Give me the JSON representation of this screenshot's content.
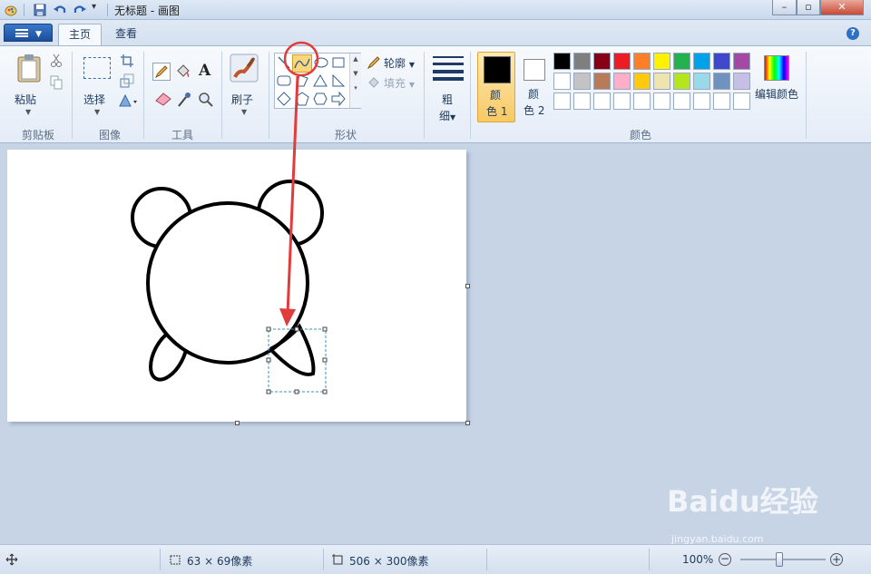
{
  "window": {
    "title": "无标题 - 画图"
  },
  "tabs": [
    {
      "label": "主页"
    },
    {
      "label": "查看"
    }
  ],
  "ribbon": {
    "clipboard": {
      "paste_label": "粘贴",
      "group_label": "剪贴板"
    },
    "image": {
      "select_label": "选择",
      "group_label": "图像"
    },
    "tools": {
      "group_label": "工具"
    },
    "brushes": {
      "label": "刷子"
    },
    "shapes": {
      "outline_label": "轮廓",
      "fill_label": "填充",
      "group_label": "形状"
    },
    "size": {
      "label_line1": "粗",
      "label_line2": "细"
    },
    "colors": {
      "color1_line1": "颜",
      "color1_line2": "色 1",
      "color2_line1": "颜",
      "color2_line2": "色 2",
      "edit_label": "编辑颜色",
      "group_label": "颜色",
      "color1": "#000000",
      "color2": "#ffffff",
      "palette_row1": [
        "#000000",
        "#7f7f7f",
        "#880015",
        "#ed1c24",
        "#ff7f27",
        "#fff200",
        "#22b14c",
        "#00a2e8",
        "#3f48cc",
        "#a349a4"
      ],
      "palette_row2": [
        "#ffffff",
        "#c3c3c3",
        "#b97a57",
        "#ffaec9",
        "#ffc90e",
        "#efe4b0",
        "#b5e61d",
        "#99d9ea",
        "#7092be",
        "#c8bfe7"
      ]
    }
  },
  "status": {
    "selection_size": "63 × 69像素",
    "canvas_size": "506 × 300像素",
    "zoom": "100%"
  },
  "watermark": {
    "brand": "Baidu经验",
    "url": "jingyan.baidu.com"
  }
}
